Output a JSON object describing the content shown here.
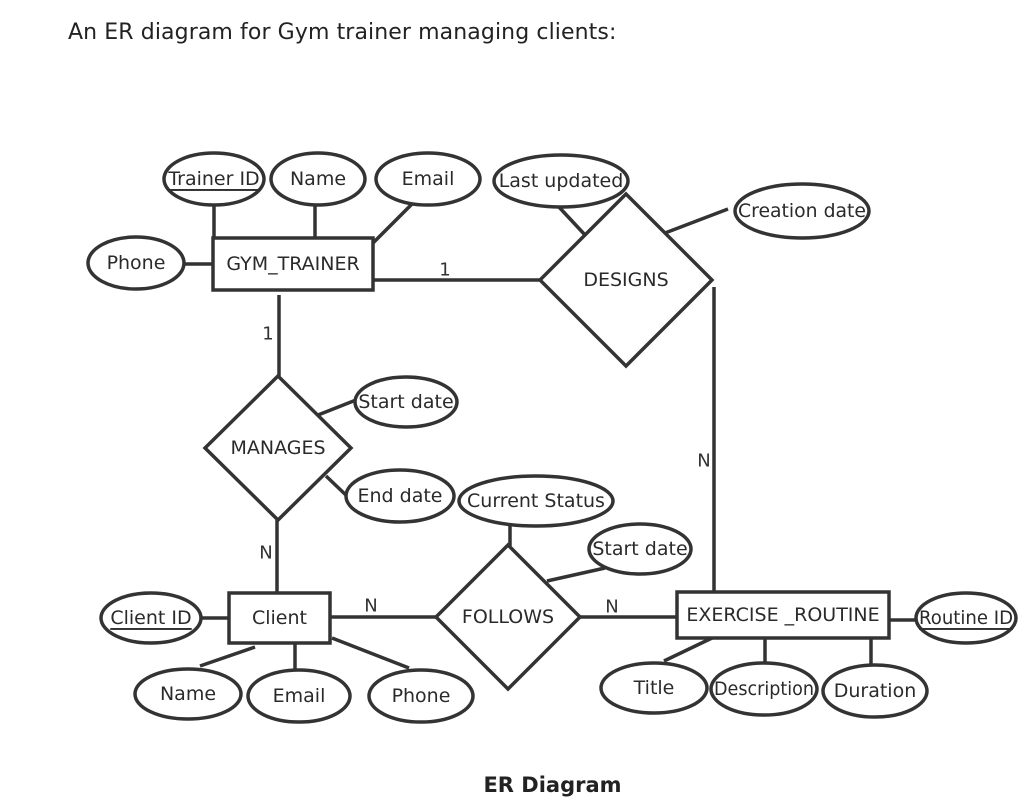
{
  "title": "An ER diagram for Gym trainer managing clients:",
  "caption": "ER Diagram",
  "colors": {
    "stroke": "#333333",
    "text": "#222222",
    "background": "#ffffff"
  },
  "entities": [
    {
      "id": "gym_trainer",
      "label": "GYM_TRAINER"
    },
    {
      "id": "client",
      "label": "Client"
    },
    {
      "id": "exercise_routine",
      "label": "EXERCISE _ROUTINE"
    }
  ],
  "relationships": [
    {
      "id": "designs",
      "label": "DESIGNS",
      "from": "gym_trainer",
      "to": "exercise_routine",
      "from_card": "1",
      "to_card": "N"
    },
    {
      "id": "manages",
      "label": "MANAGES",
      "from": "gym_trainer",
      "to": "client",
      "from_card": "1",
      "to_card": "N"
    },
    {
      "id": "follows",
      "label": "FOLLOWS",
      "from": "client",
      "to": "exercise_routine",
      "from_card": "N",
      "to_card": "N"
    }
  ],
  "attributes": [
    {
      "id": "trainer_id",
      "label": "Trainer ID",
      "owner": "gym_trainer",
      "key": true
    },
    {
      "id": "trainer_name",
      "label": "Name",
      "owner": "gym_trainer",
      "key": false
    },
    {
      "id": "trainer_email",
      "label": "Email",
      "owner": "gym_trainer",
      "key": false
    },
    {
      "id": "trainer_phone",
      "label": "Phone",
      "owner": "gym_trainer",
      "key": false
    },
    {
      "id": "designs_last_updated",
      "label": "Last updated",
      "owner": "designs",
      "key": false
    },
    {
      "id": "designs_creation_date",
      "label": "Creation date",
      "owner": "designs",
      "key": false
    },
    {
      "id": "manages_start_date",
      "label": "Start date",
      "owner": "manages",
      "key": false
    },
    {
      "id": "manages_end_date",
      "label": "End date",
      "owner": "manages",
      "key": false
    },
    {
      "id": "follows_current_status",
      "label": "Current Status",
      "owner": "follows",
      "key": false
    },
    {
      "id": "follows_start_date",
      "label": "Start date",
      "owner": "follows",
      "key": false
    },
    {
      "id": "client_id",
      "label": "Client ID",
      "owner": "client",
      "key": true
    },
    {
      "id": "client_name",
      "label": "Name",
      "owner": "client",
      "key": false
    },
    {
      "id": "client_email",
      "label": "Email",
      "owner": "client",
      "key": false
    },
    {
      "id": "client_phone",
      "label": "Phone",
      "owner": "client",
      "key": false
    },
    {
      "id": "routine_id",
      "label": "Routine ID",
      "owner": "exercise_routine",
      "key": true
    },
    {
      "id": "routine_title",
      "label": "Title",
      "owner": "exercise_routine",
      "key": false
    },
    {
      "id": "routine_description",
      "label": "Description",
      "owner": "exercise_routine",
      "key": false
    },
    {
      "id": "routine_duration",
      "label": "Duration",
      "owner": "exercise_routine",
      "key": false
    }
  ]
}
